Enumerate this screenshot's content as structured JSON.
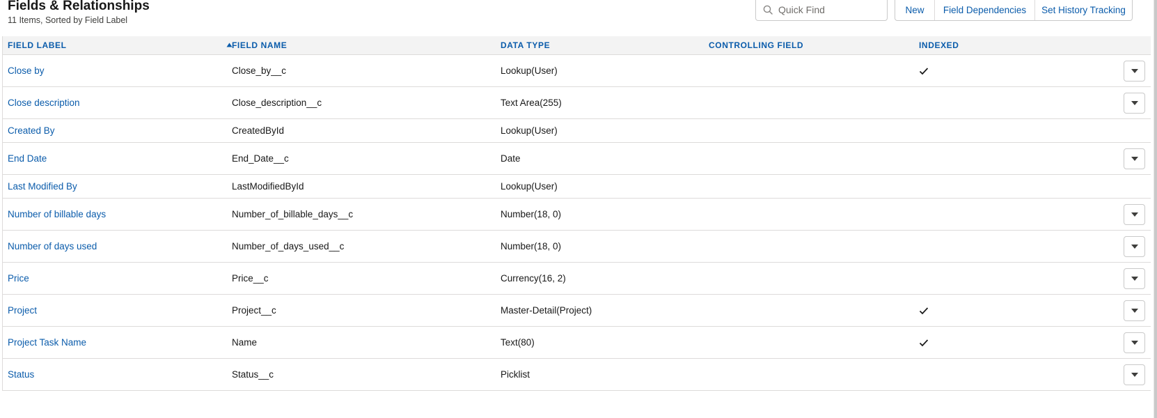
{
  "header": {
    "title": "Fields & Relationships",
    "subtitle": "11 Items, Sorted by Field Label"
  },
  "search": {
    "placeholder": "Quick Find"
  },
  "buttons": {
    "new": "New",
    "field_dependencies": "Field Dependencies",
    "set_history_tracking": "Set History Tracking"
  },
  "table": {
    "columns": [
      "FIELD LABEL",
      "FIELD NAME",
      "DATA TYPE",
      "CONTROLLING FIELD",
      "INDEXED"
    ],
    "sort_indicator": "ascending",
    "rows": [
      {
        "label": "Close by",
        "api_name": "Close_by__c",
        "data_type": "Lookup(User)",
        "controlling_field": "",
        "indexed": true,
        "has_menu": true
      },
      {
        "label": "Close description",
        "api_name": "Close_description__c",
        "data_type": "Text Area(255)",
        "controlling_field": "",
        "indexed": false,
        "has_menu": true
      },
      {
        "label": "Created By",
        "api_name": "CreatedById",
        "data_type": "Lookup(User)",
        "controlling_field": "",
        "indexed": false,
        "has_menu": false
      },
      {
        "label": "End Date",
        "api_name": "End_Date__c",
        "data_type": "Date",
        "controlling_field": "",
        "indexed": false,
        "has_menu": true
      },
      {
        "label": "Last Modified By",
        "api_name": "LastModifiedById",
        "data_type": "Lookup(User)",
        "controlling_field": "",
        "indexed": false,
        "has_menu": false
      },
      {
        "label": "Number of billable days",
        "api_name": "Number_of_billable_days__c",
        "data_type": "Number(18, 0)",
        "controlling_field": "",
        "indexed": false,
        "has_menu": true
      },
      {
        "label": "Number of days used",
        "api_name": "Number_of_days_used__c",
        "data_type": "Number(18, 0)",
        "controlling_field": "",
        "indexed": false,
        "has_menu": true
      },
      {
        "label": "Price",
        "api_name": "Price__c",
        "data_type": "Currency(16, 2)",
        "controlling_field": "",
        "indexed": false,
        "has_menu": true
      },
      {
        "label": "Project",
        "api_name": "Project__c",
        "data_type": "Master-Detail(Project)",
        "controlling_field": "",
        "indexed": true,
        "has_menu": true
      },
      {
        "label": "Project Task Name",
        "api_name": "Name",
        "data_type": "Text(80)",
        "controlling_field": "",
        "indexed": true,
        "has_menu": true
      },
      {
        "label": "Status",
        "api_name": "Status__c",
        "data_type": "Picklist",
        "controlling_field": "",
        "indexed": false,
        "has_menu": true
      }
    ]
  },
  "icons": {
    "search": "search-icon",
    "sort": "sort-ascending-icon",
    "check": "check-icon",
    "menu": "chevron-down-icon"
  },
  "colors": {
    "link": "#0b5cab",
    "header_bg": "#f3f3f3",
    "border": "#dddbda"
  }
}
